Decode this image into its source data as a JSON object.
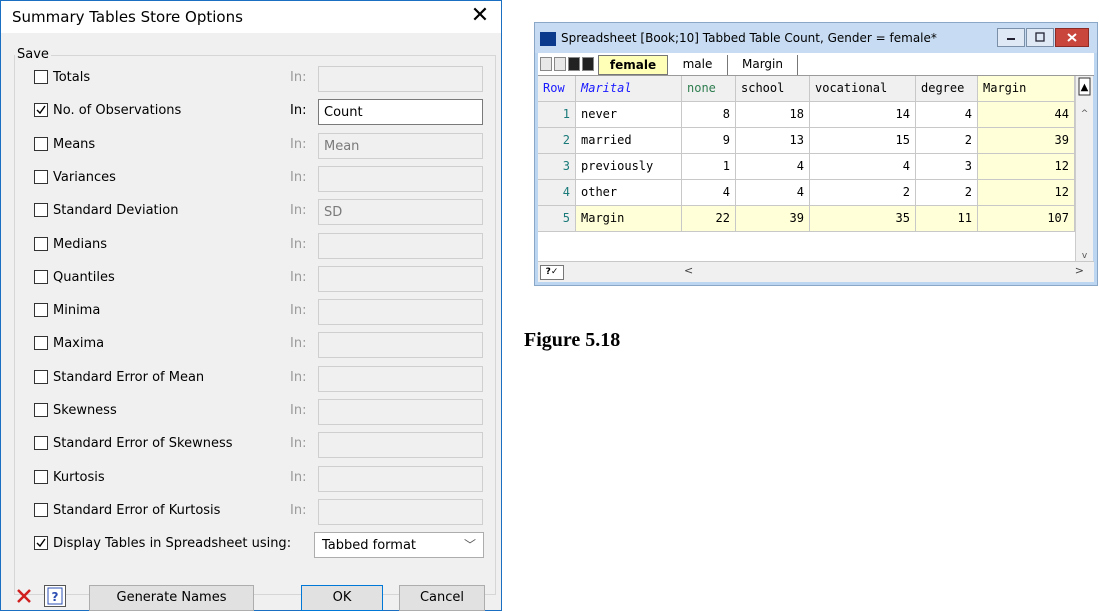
{
  "dialog": {
    "title": "Summary Tables Store Options",
    "group_label": "Save",
    "in_label": "In:",
    "rows": [
      {
        "label": "Totals",
        "checked": false,
        "in_value": "",
        "active": false
      },
      {
        "label": "No. of Observations",
        "checked": true,
        "in_value": "Count",
        "active": true
      },
      {
        "label": "Means",
        "checked": false,
        "in_value": "Mean",
        "active": false
      },
      {
        "label": "Variances",
        "checked": false,
        "in_value": "",
        "active": false
      },
      {
        "label": "Standard Deviation",
        "checked": false,
        "in_value": "SD",
        "active": false
      },
      {
        "label": "Medians",
        "checked": false,
        "in_value": "",
        "active": false
      },
      {
        "label": "Quantiles",
        "checked": false,
        "in_value": "",
        "active": false
      },
      {
        "label": "Minima",
        "checked": false,
        "in_value": "",
        "active": false
      },
      {
        "label": "Maxima",
        "checked": false,
        "in_value": "",
        "active": false
      },
      {
        "label": "Standard Error of Mean",
        "checked": false,
        "in_value": "",
        "active": false
      },
      {
        "label": "Skewness",
        "checked": false,
        "in_value": "",
        "active": false
      },
      {
        "label": "Standard Error of Skewness",
        "checked": false,
        "in_value": "",
        "active": false
      },
      {
        "label": "Kurtosis",
        "checked": false,
        "in_value": "",
        "active": false
      },
      {
        "label": "Standard Error of Kurtosis",
        "checked": false,
        "in_value": "",
        "active": false
      }
    ],
    "display_tables": {
      "label": "Display Tables in Spreadsheet using:",
      "checked": true,
      "selected": "Tabbed format"
    },
    "buttons": {
      "generate": "Generate Names",
      "ok": "OK",
      "cancel": "Cancel"
    },
    "icons": {
      "cancel_icon": "red-x-icon",
      "help_icon": "help-question-icon"
    }
  },
  "spreadsheet": {
    "title": "Spreadsheet [Book;10] Tabbed Table Count, Gender = female*",
    "tabs": [
      "female",
      "male",
      "Margin"
    ],
    "active_tab": "female",
    "columns": [
      "Row",
      "Marital",
      "none",
      "school",
      "vocational",
      "degree",
      "Margin"
    ],
    "rows": [
      {
        "row": "1",
        "marital": "never",
        "none": "8",
        "school": "18",
        "vocational": "14",
        "degree": "4",
        "margin": "44"
      },
      {
        "row": "2",
        "marital": "married",
        "none": "9",
        "school": "13",
        "vocational": "15",
        "degree": "2",
        "margin": "39"
      },
      {
        "row": "3",
        "marital": "previously",
        "none": "1",
        "school": "4",
        "vocational": "4",
        "degree": "3",
        "margin": "12"
      },
      {
        "row": "4",
        "marital": "other",
        "none": "4",
        "school": "4",
        "vocational": "2",
        "degree": "2",
        "margin": "12"
      },
      {
        "row": "5",
        "marital": "Margin",
        "none": "22",
        "school": "39",
        "vocational": "35",
        "degree": "11",
        "margin": "107"
      }
    ],
    "status_icon": "help-check-icon",
    "colors": {
      "margin_bg": "#ffffd8",
      "row_num": "#1a7a7a",
      "marital_header": "#1a1aff",
      "none_header": "#2e7d4f"
    }
  },
  "figure_caption": "Figure 5.18"
}
